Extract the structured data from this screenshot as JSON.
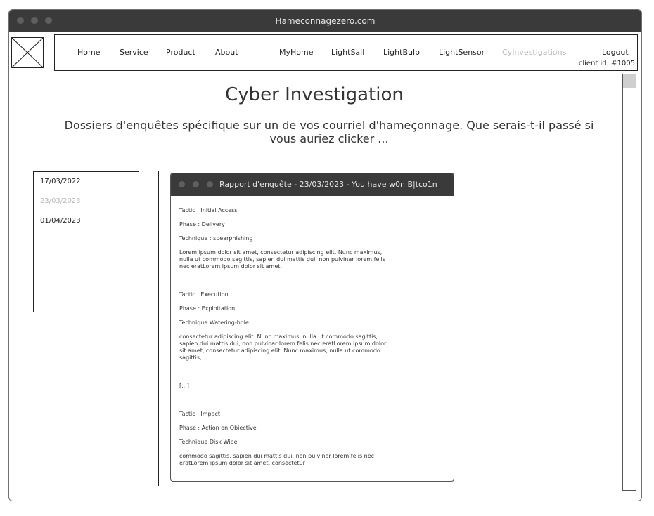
{
  "window": {
    "title": "Hameconnagezero.com"
  },
  "nav": {
    "items": [
      {
        "label": "Home",
        "active": true
      },
      {
        "label": "Service",
        "active": true
      },
      {
        "label": "Product",
        "active": true
      },
      {
        "label": "About",
        "active": true
      },
      {
        "label": "MyHome",
        "active": true
      },
      {
        "label": "LightSail",
        "active": true
      },
      {
        "label": "LightBulb",
        "active": true
      },
      {
        "label": "LightSensor",
        "active": true
      },
      {
        "label": "CyInvestigations",
        "active": false
      },
      {
        "label": "Logout",
        "active": true
      }
    ],
    "client_id": "client id: #1005"
  },
  "page": {
    "title": "Cyber Investigation",
    "subtitle": "Dossiers d'enquêtes spécifique sur un de vos courriel d'hameçonnage. Que serais-t-il passé si vous auriez clicker ..."
  },
  "dates": [
    {
      "label": "17/03/2022",
      "selected": false
    },
    {
      "label": "23/03/2023",
      "selected": true
    },
    {
      "label": "01/04/2023",
      "selected": false
    }
  ],
  "report": {
    "title": "Rapport d'enquête - 23/03/2023 - You have w0n B|tco1n",
    "blocks": [
      {
        "tactic": "Tactic : Initial Access",
        "phase": "Phase : Delivery",
        "technique": "Technique : spearphishing",
        "text": "Lorem ipsum dolor sit amet, consectetur adipiscing elit. Nunc maximus,\nnulla ut commodo sagittis, sapien dui mattis dui, non pulvinar lorem felis\nnec eratLorem ipsum dolor sit amet,"
      },
      {
        "tactic": "Tactic : Execution",
        "phase": "Phase : Exploitation",
        "technique": "Technique Watering-hole",
        "text": "consectetur adipiscing elit. Nunc maximus, nulla ut commodo sagittis,\nsapien dui mattis dui, non pulvinar lorem felis nec eratLorem ipsum dolor\nsit amet, consectetur adipiscing elit. Nunc maximus, nulla ut commodo\nsagittis,"
      },
      {
        "ellipsis": "[...]"
      },
      {
        "tactic": "Tactic : Impact",
        "phase": "Phase : Action on Objective",
        "technique": "Technique Disk Wipe",
        "text": "commodo sagittis, sapien dui mattis dui, non pulvinar lorem felis nec\neratLorem ipsum dolor sit amet, consectetur"
      }
    ]
  },
  "icons": {
    "logo": "image-placeholder-icon",
    "window_controls": "traffic-light-dots"
  }
}
